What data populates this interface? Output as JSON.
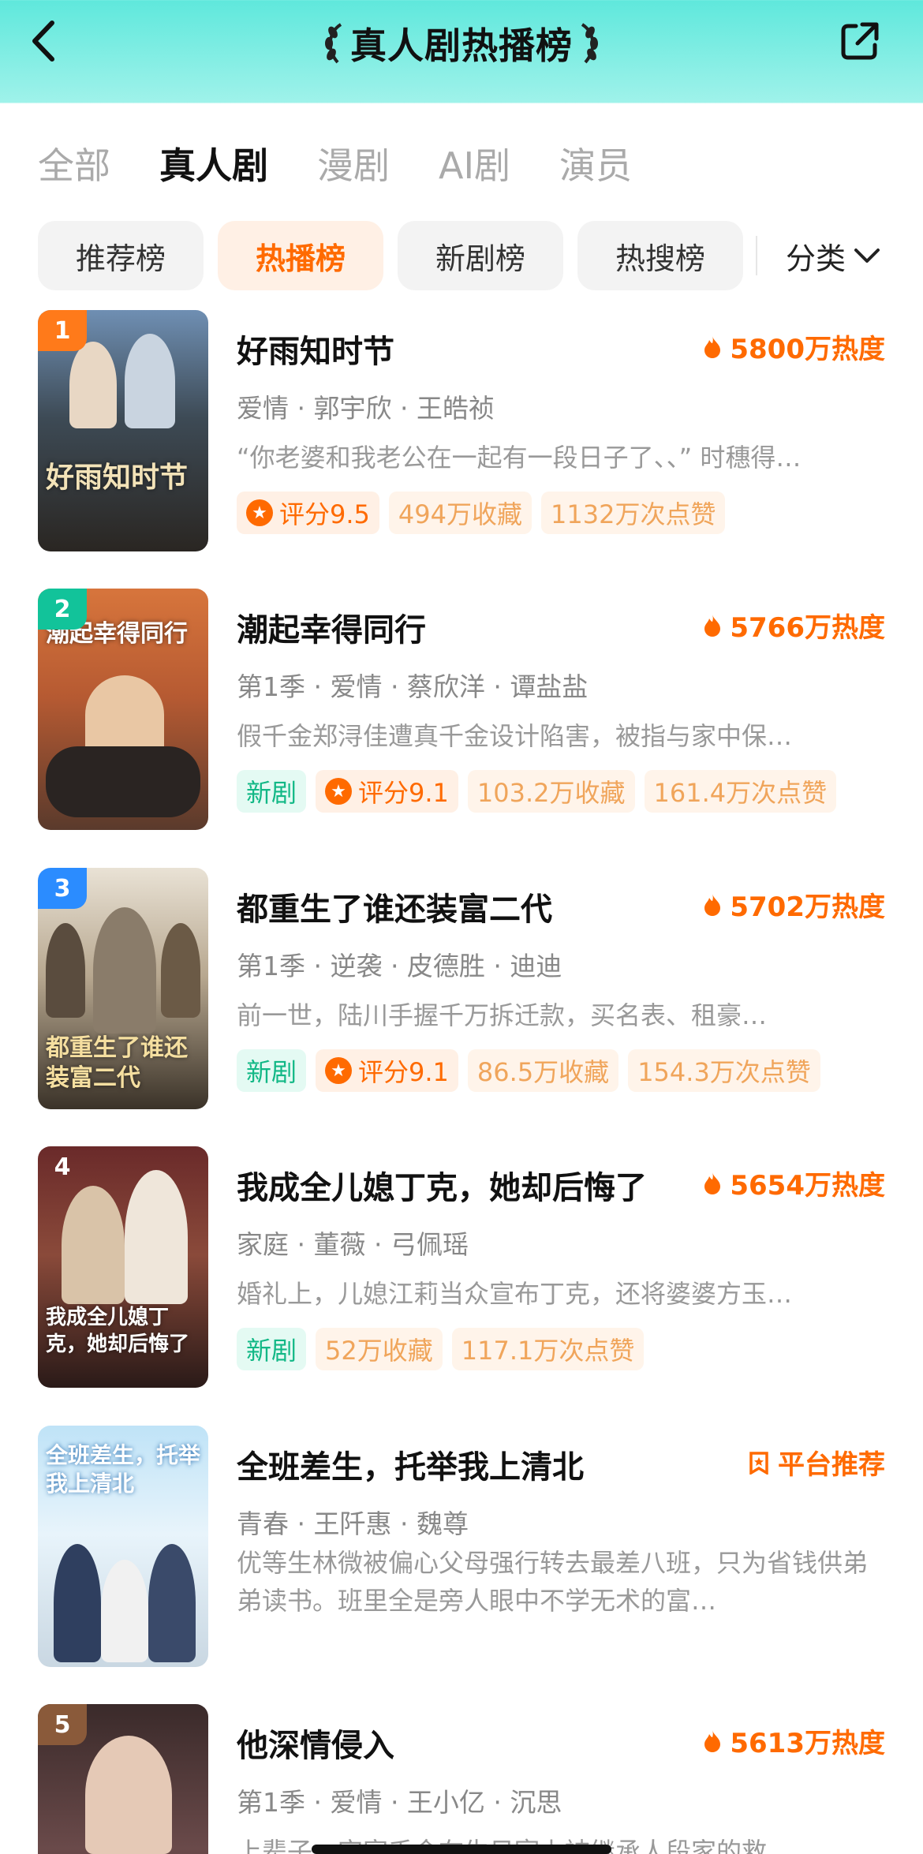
{
  "header": {
    "title": "真人剧热播榜",
    "back_icon": "chevron-left-icon",
    "share_icon": "share-icon"
  },
  "tabs": [
    {
      "label": "全部",
      "active": false
    },
    {
      "label": "真人剧",
      "active": true
    },
    {
      "label": "漫剧",
      "active": false
    },
    {
      "label": "AI剧",
      "active": false
    },
    {
      "label": "演员",
      "active": false
    }
  ],
  "chips": [
    {
      "label": "推荐榜",
      "active": false
    },
    {
      "label": "热播榜",
      "active": true
    },
    {
      "label": "新剧榜",
      "active": false
    },
    {
      "label": "热搜榜",
      "active": false
    }
  ],
  "category_label": "分类",
  "colors": {
    "accent": "#ff6a00",
    "new_badge": "#12b886",
    "rank1": "#ff7a1a",
    "rank2": "#12c39a",
    "rank3": "#2b8cff",
    "rank_other": "#8a5a3a"
  },
  "items": [
    {
      "rank": "1",
      "name": "好雨知时节",
      "heat": "5800万热度",
      "meta": "爱情 · 郭宇欣 · 王皓祯",
      "desc": "“你老婆和我老公在一起有一段日子了、、” 时穗得…",
      "badges": [
        {
          "type": "score",
          "text": "评分9.5"
        },
        {
          "type": "plain",
          "text": "494万收藏"
        },
        {
          "type": "plain",
          "text": "1132万次点赞"
        }
      ],
      "cover_text": "好雨知时节"
    },
    {
      "rank": "2",
      "name": "潮起幸得同行",
      "heat": "5766万热度",
      "meta": "第1季 · 爱情 · 蔡欣洋 · 谭盐盐",
      "desc": "假千金郑浔佳遭真千金设计陷害，被指与家中保…",
      "badges": [
        {
          "type": "new",
          "text": "新剧"
        },
        {
          "type": "score",
          "text": "评分9.1"
        },
        {
          "type": "plain",
          "text": "103.2万收藏"
        },
        {
          "type": "plain",
          "text": "161.4万次点赞"
        }
      ],
      "cover_text": "潮起幸得同行"
    },
    {
      "rank": "3",
      "name": "都重生了谁还装富二代",
      "heat": "5702万热度",
      "meta": "第1季 · 逆袭 · 皮德胜 · 迪迪",
      "desc": "前一世，陆川手握千万拆迁款，买名表、租豪…",
      "badges": [
        {
          "type": "new",
          "text": "新剧"
        },
        {
          "type": "score",
          "text": "评分9.1"
        },
        {
          "type": "plain",
          "text": "86.5万收藏"
        },
        {
          "type": "plain",
          "text": "154.3万次点赞"
        }
      ],
      "cover_text": "都重生了谁还装富二代"
    },
    {
      "rank": "4",
      "name": "我成全儿媳丁克，她却后悔了",
      "heat": "5654万热度",
      "meta": "家庭 · 董薇 · 弓佩瑶",
      "desc": "婚礼上，儿媳江莉当众宣布丁克，还将婆婆方玉…",
      "badges": [
        {
          "type": "new",
          "text": "新剧"
        },
        {
          "type": "plain",
          "text": "52万收藏"
        },
        {
          "type": "plain",
          "text": "117.1万次点赞"
        }
      ],
      "cover_text": "我成全儿媳丁克，她却后悔了"
    },
    {
      "rank": "",
      "name": "全班差生，托举我上清北",
      "heat": "平台推荐",
      "meta": "青春 · 王阡惠 · 魏尊",
      "desc": "优等生林微被偏心父母强行转去最差八班，只为省钱供弟弟读书。班里全是旁人眼中不学无术的富…",
      "badges": [],
      "cover_text": "全班差生，托举我上清北"
    },
    {
      "rank": "5",
      "name": "他深情侵入",
      "heat": "5613万热度",
      "meta": "第1季 · 爱情 · 王小亿 · 沉思",
      "desc": "上辈子，宋家千金在生日宴上被继承人段家的救…",
      "badges": [],
      "cover_text": ""
    }
  ]
}
